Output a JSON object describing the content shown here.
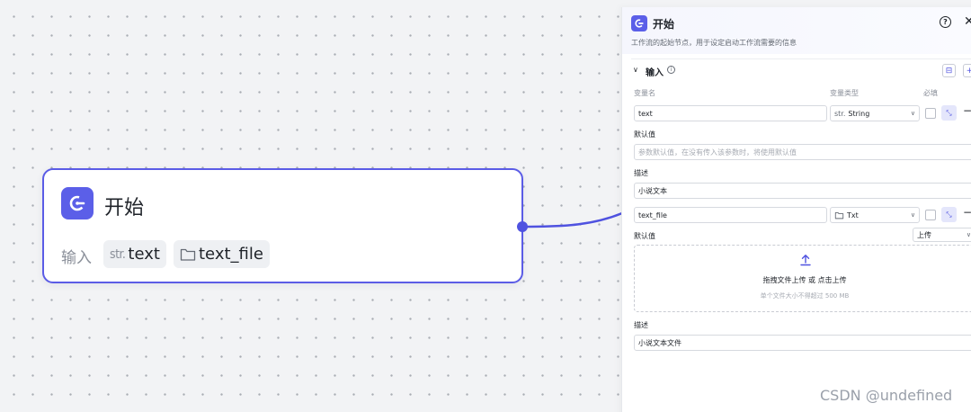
{
  "node": {
    "title": "开始",
    "input_label": "输入",
    "inputs": [
      {
        "type_badge": "str.",
        "name": "text"
      },
      {
        "type_badge": "",
        "name": "text_file"
      }
    ]
  },
  "panel": {
    "title": "开始",
    "description": "工作流的起始节点，用于设定启动工作流需要的信息",
    "help_symbol": "?",
    "close_symbol": "✕",
    "section": {
      "title": "输入",
      "columns": {
        "name": "变量名",
        "type": "变量类型",
        "required": "必填"
      },
      "var1": {
        "name": "text",
        "type": "String",
        "type_prefix": "str.",
        "default_label": "默认值",
        "default_placeholder": "参数默认值，在没有传入该参数时，将使用默认值",
        "desc_label": "描述",
        "desc_value": "小说文本"
      },
      "var2": {
        "name": "text_file",
        "type": "Txt",
        "default_label": "默认值",
        "upload_mode": "上传",
        "upload_text": "拖拽文件上传 或 点击上传",
        "upload_hint": "单个文件大小不得超过 500 MB",
        "desc_label": "描述",
        "desc_value": "小说文本文件"
      }
    }
  },
  "watermark": "CSDN @undefined",
  "colors": {
    "accent": "#5b5ce6",
    "canvas": "#f2f3f5"
  }
}
